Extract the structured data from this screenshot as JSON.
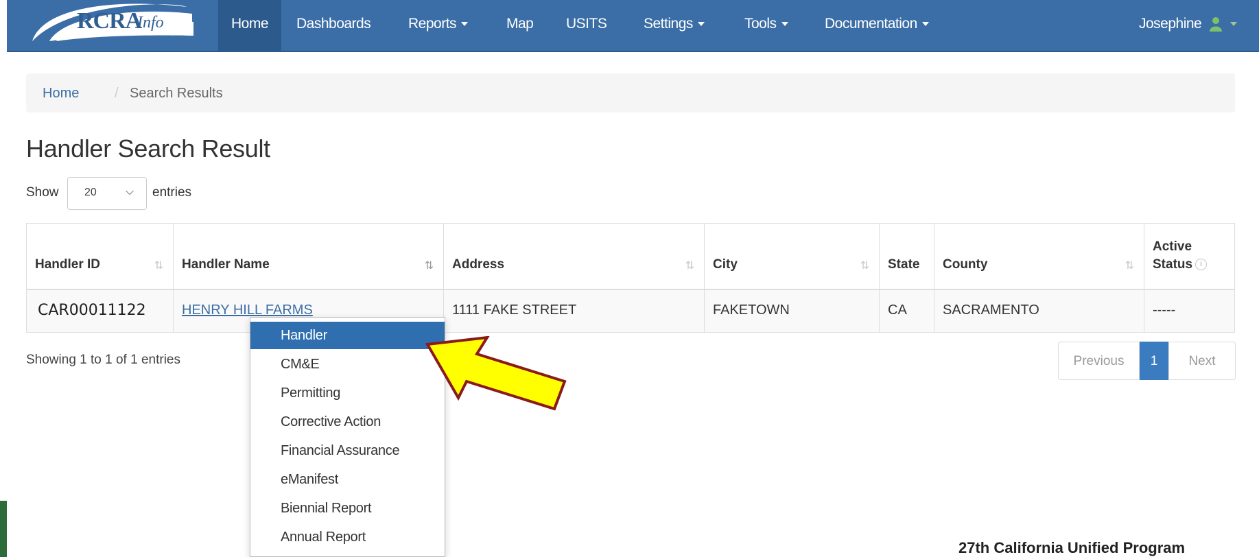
{
  "brand": {
    "logo_main": "RCRA",
    "logo_suffix": "Info"
  },
  "nav": {
    "home": "Home",
    "dashboards": "Dashboards",
    "reports": "Reports",
    "map": "Map",
    "usits": "USITS",
    "settings": "Settings",
    "tools": "Tools",
    "documentation": "Documentation",
    "user": "Josephine"
  },
  "breadcrumb": {
    "home": "Home",
    "separator": "/",
    "current": "Search Results"
  },
  "page_title": "Handler Search Result",
  "length_control": {
    "show": "Show",
    "value": "20",
    "entries": "entries"
  },
  "table": {
    "headers": {
      "handler_id": "Handler ID",
      "handler_name": "Handler Name",
      "address": "Address",
      "city": "City",
      "state": "State",
      "county": "County",
      "active_status_line1": "Active",
      "active_status_line2": "Status"
    },
    "rows": [
      {
        "handler_id": "CAR00011122",
        "handler_name": "HENRY HILL FARMS",
        "address": "1111 FAKE STREET",
        "city": "FAKETOWN",
        "state": "CA",
        "county": "SACRAMENTO",
        "active_status": "-----"
      }
    ]
  },
  "table_info": "Showing 1 to 1 of 1 entries",
  "pagination": {
    "previous": "Previous",
    "current": "1",
    "next": "Next"
  },
  "dropdown_menu": {
    "items": [
      "Handler",
      "CM&E",
      "Permitting",
      "Corrective Action",
      "Financial Assurance",
      "eManifest",
      "Biennial Report",
      "Annual Report"
    ],
    "active_index": 0
  },
  "footer_note": "27th California Unified Program",
  "colors": {
    "navbar": "#3b6ea6",
    "link": "#3b6ea6",
    "highlight": "#2f6fb0",
    "arrow_fill": "#ffff00",
    "arrow_stroke": "#8b1a1a"
  }
}
